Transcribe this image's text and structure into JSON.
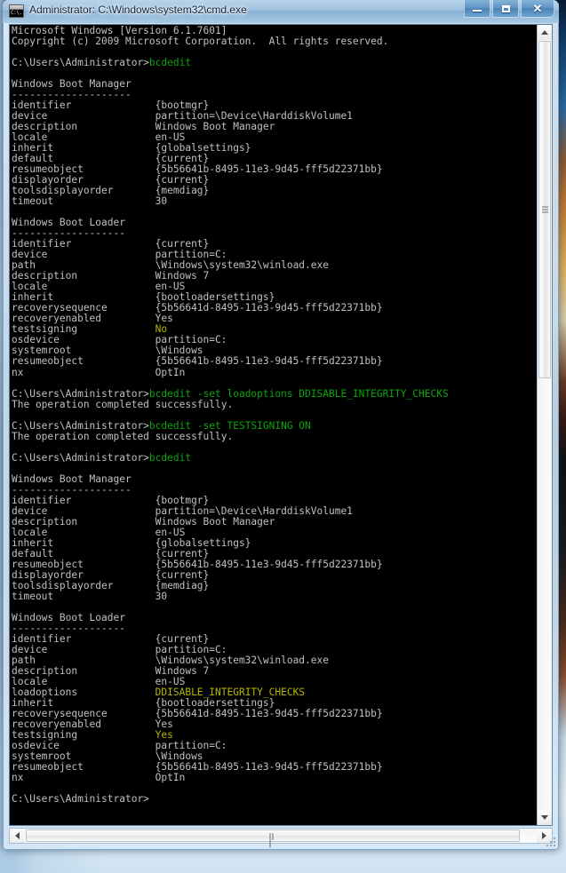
{
  "window": {
    "title": "Administrator: C:\\Windows\\system32\\cmd.exe",
    "icon_name": "cmd-console-icon",
    "icon_text": "C:\\.",
    "controls": {
      "minimize_label": "–",
      "maximize_label": "□",
      "close_label": "✕"
    }
  },
  "colors": {
    "console_background": "#000000",
    "console_foreground": "#c0c0c0",
    "highlight_green": "#0ba40b",
    "highlight_yellow": "#b6b600",
    "titlebar_accent": "#88b0d4"
  },
  "scrollbars": {
    "vertical": {
      "up_arrow": "scroll-up-arrow",
      "down_arrow": "scroll-down-arrow",
      "thumb": "vertical-scroll-thumb"
    },
    "horizontal": {
      "left_arrow": "scroll-left-arrow",
      "right_arrow": "scroll-right-arrow",
      "thumb": "horizontal-scroll-thumb"
    }
  },
  "console": {
    "prompt": "C:\\Users\\Administrator>",
    "lines": [
      {
        "segments": [
          {
            "text": "Microsoft Windows [Version 6.1.7601]",
            "color": "gray"
          }
        ]
      },
      {
        "segments": [
          {
            "text": "Copyright (c) 2009 Microsoft Corporation.  All rights reserved.",
            "color": "gray"
          }
        ]
      },
      {
        "segments": [
          {
            "text": "",
            "color": "gray"
          }
        ]
      },
      {
        "segments": [
          {
            "text": "C:\\Users\\Administrator>",
            "color": "gray"
          },
          {
            "text": "bcdedit",
            "color": "green"
          }
        ]
      },
      {
        "segments": [
          {
            "text": "",
            "color": "gray"
          }
        ]
      },
      {
        "segments": [
          {
            "text": "Windows Boot Manager",
            "color": "gray"
          }
        ]
      },
      {
        "segments": [
          {
            "text": "--------------------",
            "color": "gray"
          }
        ]
      },
      {
        "segments": [
          {
            "text": "identifier              {bootmgr}",
            "color": "gray"
          }
        ]
      },
      {
        "segments": [
          {
            "text": "device                  partition=\\Device\\HarddiskVolume1",
            "color": "gray"
          }
        ]
      },
      {
        "segments": [
          {
            "text": "description             Windows Boot Manager",
            "color": "gray"
          }
        ]
      },
      {
        "segments": [
          {
            "text": "locale                  en-US",
            "color": "gray"
          }
        ]
      },
      {
        "segments": [
          {
            "text": "inherit                 {globalsettings}",
            "color": "gray"
          }
        ]
      },
      {
        "segments": [
          {
            "text": "default                 {current}",
            "color": "gray"
          }
        ]
      },
      {
        "segments": [
          {
            "text": "resumeobject            {5b56641b-8495-11e3-9d45-fff5d22371bb}",
            "color": "gray"
          }
        ]
      },
      {
        "segments": [
          {
            "text": "displayorder            {current}",
            "color": "gray"
          }
        ]
      },
      {
        "segments": [
          {
            "text": "toolsdisplayorder       {memdiag}",
            "color": "gray"
          }
        ]
      },
      {
        "segments": [
          {
            "text": "timeout                 30",
            "color": "gray"
          }
        ]
      },
      {
        "segments": [
          {
            "text": "",
            "color": "gray"
          }
        ]
      },
      {
        "segments": [
          {
            "text": "Windows Boot Loader",
            "color": "gray"
          }
        ]
      },
      {
        "segments": [
          {
            "text": "-------------------",
            "color": "gray"
          }
        ]
      },
      {
        "segments": [
          {
            "text": "identifier              {current}",
            "color": "gray"
          }
        ]
      },
      {
        "segments": [
          {
            "text": "device                  partition=C:",
            "color": "gray"
          }
        ]
      },
      {
        "segments": [
          {
            "text": "path                    \\Windows\\system32\\winload.exe",
            "color": "gray"
          }
        ]
      },
      {
        "segments": [
          {
            "text": "description             Windows 7",
            "color": "gray"
          }
        ]
      },
      {
        "segments": [
          {
            "text": "locale                  en-US",
            "color": "gray"
          }
        ]
      },
      {
        "segments": [
          {
            "text": "inherit                 {bootloadersettings}",
            "color": "gray"
          }
        ]
      },
      {
        "segments": [
          {
            "text": "recoverysequence        {5b56641d-8495-11e3-9d45-fff5d22371bb}",
            "color": "gray"
          }
        ]
      },
      {
        "segments": [
          {
            "text": "recoveryenabled         Yes",
            "color": "gray"
          }
        ]
      },
      {
        "segments": [
          {
            "text": "testsigning             ",
            "color": "gray"
          },
          {
            "text": "No",
            "color": "yellow"
          }
        ]
      },
      {
        "segments": [
          {
            "text": "osdevice                partition=C:",
            "color": "gray"
          }
        ]
      },
      {
        "segments": [
          {
            "text": "systemroot              \\Windows",
            "color": "gray"
          }
        ]
      },
      {
        "segments": [
          {
            "text": "resumeobject            {5b56641b-8495-11e3-9d45-fff5d22371bb}",
            "color": "gray"
          }
        ]
      },
      {
        "segments": [
          {
            "text": "nx                      OptIn",
            "color": "gray"
          }
        ]
      },
      {
        "segments": [
          {
            "text": "",
            "color": "gray"
          }
        ]
      },
      {
        "segments": [
          {
            "text": "C:\\Users\\Administrator>",
            "color": "gray"
          },
          {
            "text": "bcdedit -set loadoptions DDISABLE_INTEGRITY_CHECKS",
            "color": "green"
          }
        ]
      },
      {
        "segments": [
          {
            "text": "The operation completed successfully.",
            "color": "gray"
          }
        ]
      },
      {
        "segments": [
          {
            "text": "",
            "color": "gray"
          }
        ]
      },
      {
        "segments": [
          {
            "text": "C:\\Users\\Administrator>",
            "color": "gray"
          },
          {
            "text": "bcdedit -set TESTSIGNING ON",
            "color": "green"
          }
        ]
      },
      {
        "segments": [
          {
            "text": "The operation completed successfully.",
            "color": "gray"
          }
        ]
      },
      {
        "segments": [
          {
            "text": "",
            "color": "gray"
          }
        ]
      },
      {
        "segments": [
          {
            "text": "C:\\Users\\Administrator>",
            "color": "gray"
          },
          {
            "text": "bcdedit",
            "color": "green"
          }
        ]
      },
      {
        "segments": [
          {
            "text": "",
            "color": "gray"
          }
        ]
      },
      {
        "segments": [
          {
            "text": "Windows Boot Manager",
            "color": "gray"
          }
        ]
      },
      {
        "segments": [
          {
            "text": "--------------------",
            "color": "gray"
          }
        ]
      },
      {
        "segments": [
          {
            "text": "identifier              {bootmgr}",
            "color": "gray"
          }
        ]
      },
      {
        "segments": [
          {
            "text": "device                  partition=\\Device\\HarddiskVolume1",
            "color": "gray"
          }
        ]
      },
      {
        "segments": [
          {
            "text": "description             Windows Boot Manager",
            "color": "gray"
          }
        ]
      },
      {
        "segments": [
          {
            "text": "locale                  en-US",
            "color": "gray"
          }
        ]
      },
      {
        "segments": [
          {
            "text": "inherit                 {globalsettings}",
            "color": "gray"
          }
        ]
      },
      {
        "segments": [
          {
            "text": "default                 {current}",
            "color": "gray"
          }
        ]
      },
      {
        "segments": [
          {
            "text": "resumeobject            {5b56641b-8495-11e3-9d45-fff5d22371bb}",
            "color": "gray"
          }
        ]
      },
      {
        "segments": [
          {
            "text": "displayorder            {current}",
            "color": "gray"
          }
        ]
      },
      {
        "segments": [
          {
            "text": "toolsdisplayorder       {memdiag}",
            "color": "gray"
          }
        ]
      },
      {
        "segments": [
          {
            "text": "timeout                 30",
            "color": "gray"
          }
        ]
      },
      {
        "segments": [
          {
            "text": "",
            "color": "gray"
          }
        ]
      },
      {
        "segments": [
          {
            "text": "Windows Boot Loader",
            "color": "gray"
          }
        ]
      },
      {
        "segments": [
          {
            "text": "-------------------",
            "color": "gray"
          }
        ]
      },
      {
        "segments": [
          {
            "text": "identifier              {current}",
            "color": "gray"
          }
        ]
      },
      {
        "segments": [
          {
            "text": "device                  partition=C:",
            "color": "gray"
          }
        ]
      },
      {
        "segments": [
          {
            "text": "path                    \\Windows\\system32\\winload.exe",
            "color": "gray"
          }
        ]
      },
      {
        "segments": [
          {
            "text": "description             Windows 7",
            "color": "gray"
          }
        ]
      },
      {
        "segments": [
          {
            "text": "locale                  en-US",
            "color": "gray"
          }
        ]
      },
      {
        "segments": [
          {
            "text": "loadoptions             ",
            "color": "gray"
          },
          {
            "text": "DDISABLE_INTEGRITY_CHECKS",
            "color": "yellow"
          }
        ]
      },
      {
        "segments": [
          {
            "text": "inherit                 {bootloadersettings}",
            "color": "gray"
          }
        ]
      },
      {
        "segments": [
          {
            "text": "recoverysequence        {5b56641d-8495-11e3-9d45-fff5d22371bb}",
            "color": "gray"
          }
        ]
      },
      {
        "segments": [
          {
            "text": "recoveryenabled         Yes",
            "color": "gray"
          }
        ]
      },
      {
        "segments": [
          {
            "text": "testsigning             ",
            "color": "gray"
          },
          {
            "text": "Yes",
            "color": "yellow"
          }
        ]
      },
      {
        "segments": [
          {
            "text": "osdevice                partition=C:",
            "color": "gray"
          }
        ]
      },
      {
        "segments": [
          {
            "text": "systemroot              \\Windows",
            "color": "gray"
          }
        ]
      },
      {
        "segments": [
          {
            "text": "resumeobject            {5b56641b-8495-11e3-9d45-fff5d22371bb}",
            "color": "gray"
          }
        ]
      },
      {
        "segments": [
          {
            "text": "nx                      OptIn",
            "color": "gray"
          }
        ]
      },
      {
        "segments": [
          {
            "text": "",
            "color": "gray"
          }
        ]
      },
      {
        "segments": [
          {
            "text": "C:\\Users\\Administrator>",
            "color": "gray"
          }
        ]
      }
    ]
  }
}
